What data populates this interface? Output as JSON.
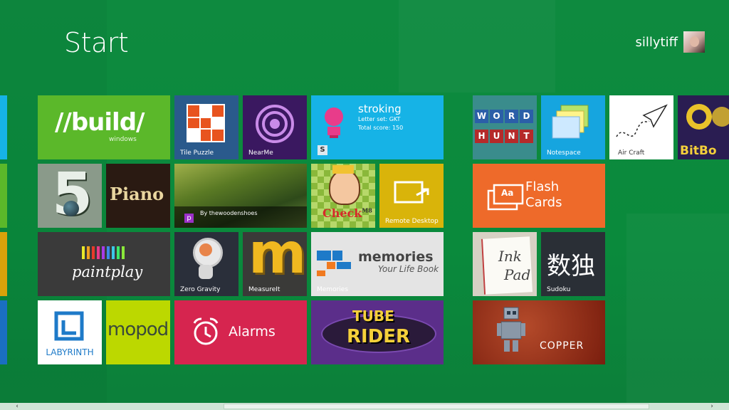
{
  "header": {
    "title": "Start",
    "user_name": "sillytiff"
  },
  "tiles": {
    "build": {
      "title": "//build/",
      "subtitle": "windows"
    },
    "tile_puzzle": {
      "label": "Tile Puzzle"
    },
    "nearme": {
      "label": "NearMe"
    },
    "stroking": {
      "title": "stroking",
      "line1": "Letter set: GKT",
      "line2": "Total score: 150"
    },
    "five": {
      "text": "5"
    },
    "piano": {
      "text": "Piano"
    },
    "photo": {
      "label": "By thewoodenshoes"
    },
    "check": {
      "text": "Check",
      "sup": "M8"
    },
    "remote_desktop": {
      "label": "Remote Desktop"
    },
    "paintplay": {
      "text": "paintplay"
    },
    "zero_gravity": {
      "label": "Zero Gravity"
    },
    "measureit": {
      "label": "MeasureIt",
      "text": "m"
    },
    "memories": {
      "title": "memories",
      "subtitle": "Your Life Book",
      "label": "Memories"
    },
    "labyrinth": {
      "label": "LABYRINTH"
    },
    "mopod": {
      "text": "mopod"
    },
    "alarms": {
      "label": "Alarms"
    },
    "tube_rider": {
      "line1": "TUBE",
      "line2": "RIDER"
    },
    "word_hunt": {
      "row1": [
        "W",
        "O",
        "R",
        "D"
      ],
      "row2": [
        "H",
        "U",
        "N",
        "T"
      ]
    },
    "notespace": {
      "label": "Notespace"
    },
    "air_craft": {
      "label": "Air Craft"
    },
    "bitbox": {
      "text": "BitBo"
    },
    "flash_cards": {
      "line1": "Flash",
      "line2": "Cards",
      "icon_text": "Aa"
    },
    "ink_pad": {
      "line1": "Ink",
      "line2": "Pad"
    },
    "sudoku": {
      "text": "数独",
      "label": "Sudoku"
    },
    "copper": {
      "label": "COPPER"
    }
  },
  "scrollbar": {
    "left_arrow": "‹",
    "right_arrow": "›"
  },
  "colors": {
    "background": "#0a8a3c",
    "build": "#5bb82a",
    "tile_puzzle": "#2a5a8c",
    "nearme": "#3a1860",
    "stroking": "#16b3e6",
    "remote_desktop": "#d9b40a",
    "paintplay": "#3a3a3a",
    "memories": "#e4e4e4",
    "labyrinth": "#ffffff",
    "mopod": "#bcd800",
    "alarms": "#d6254f",
    "tube_rider": "#5b2e8a",
    "notespace": "#16a5df",
    "flash_cards": "#ee6a2a",
    "sudoku": "#2a2f36",
    "copper": "#8a2412"
  }
}
